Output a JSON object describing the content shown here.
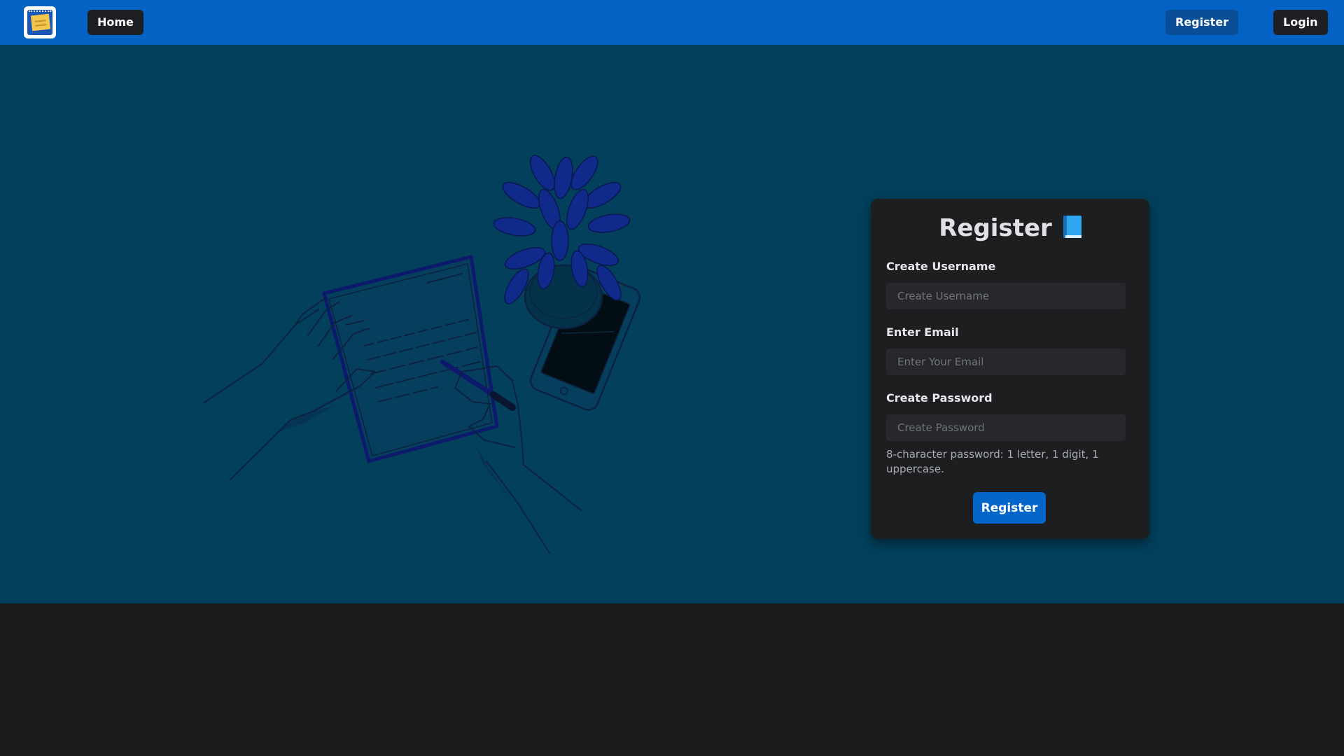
{
  "navbar": {
    "logo_icon": "sticky-notes-logo",
    "home_label": "Home",
    "register_label": "Register",
    "login_label": "Login",
    "background_color": "#0462c4"
  },
  "hero": {
    "illustration": "person-writing-letter-illustration",
    "background_color": "#02405c"
  },
  "form": {
    "title": "Register",
    "title_icon": "blue-book-icon",
    "username_label": "Create Username",
    "username_placeholder": "Create Username",
    "email_label": "Enter Email",
    "email_placeholder": "Enter Your Email",
    "password_label": "Create Password",
    "password_placeholder": "Create Password",
    "password_hint": "8-character password: 1 letter, 1 digit, 1 uppercase.",
    "submit_label": "Register",
    "accent_color": "#0466c8"
  }
}
